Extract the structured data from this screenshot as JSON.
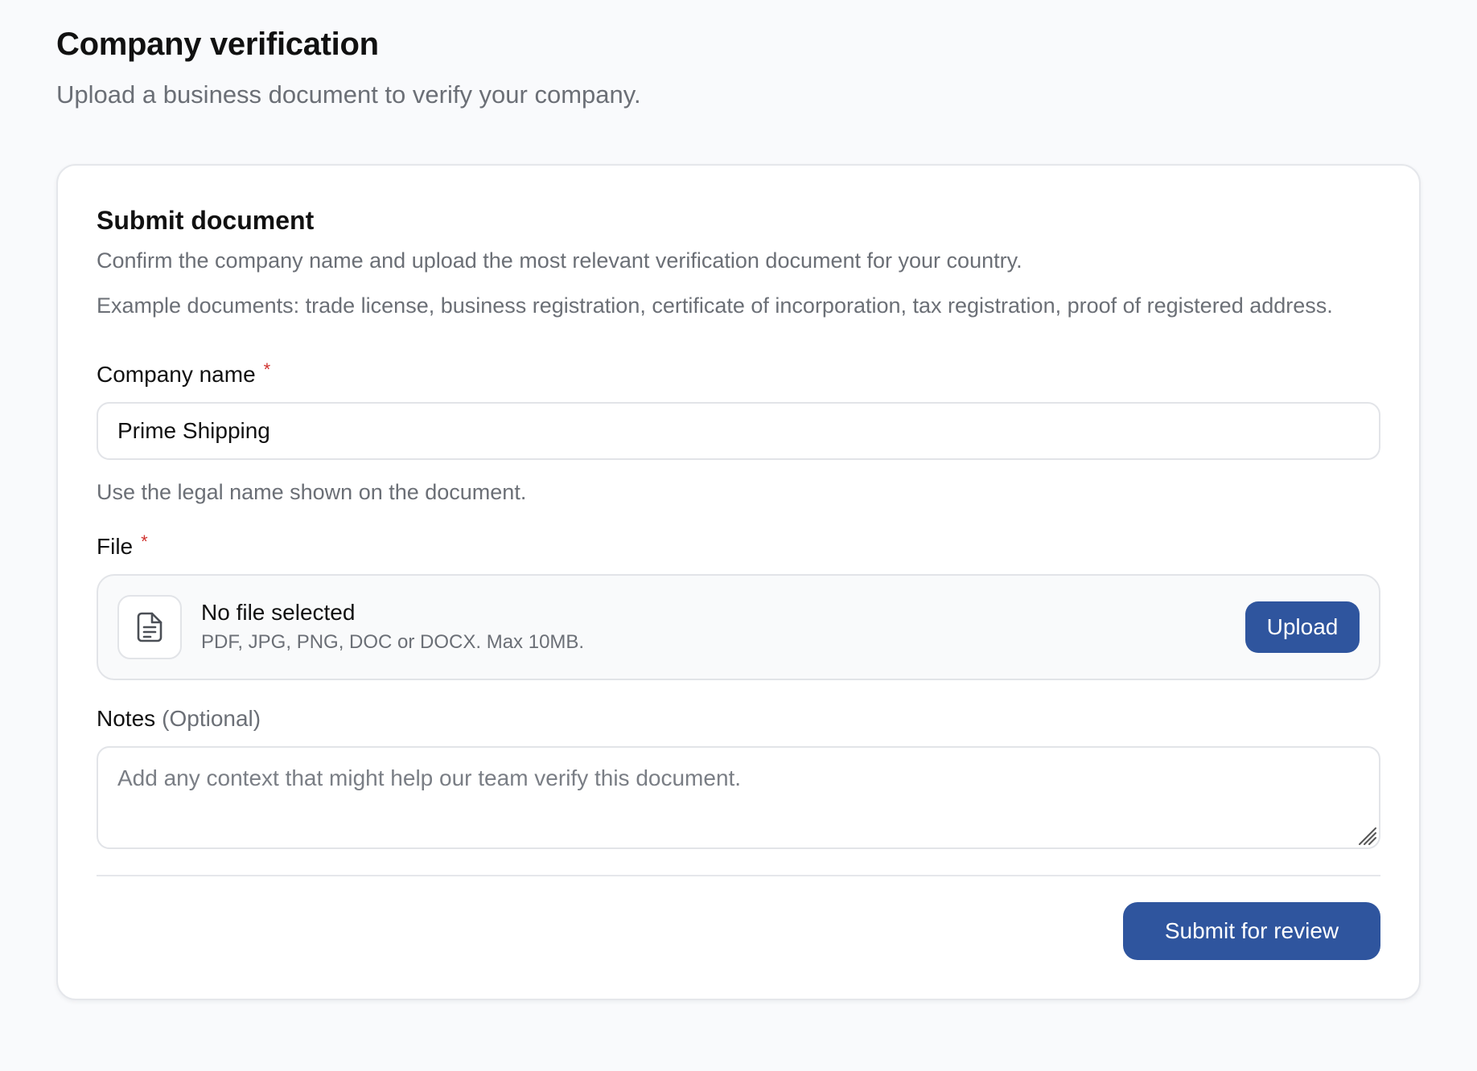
{
  "header": {
    "title": "Company verification",
    "subtitle": "Upload a business document to verify your company."
  },
  "card": {
    "title": "Submit document",
    "description": "Confirm the company name and upload the most relevant verification document for your country.",
    "examples": "Example documents: trade license, business registration, certificate of incorporation, tax registration, proof of registered address."
  },
  "company_name": {
    "label": "Company name",
    "required_mark": "*",
    "value": "Prime Shipping",
    "helper": "Use the legal name shown on the document."
  },
  "file": {
    "label": "File",
    "required_mark": "*",
    "status": "No file selected",
    "hint": "PDF, JPG, PNG, DOC or DOCX. Max 10MB.",
    "upload_label": "Upload",
    "icon": "document-icon"
  },
  "notes": {
    "label": "Notes",
    "optional": "(Optional)",
    "placeholder": "Add any context that might help our team verify this document.",
    "value": ""
  },
  "actions": {
    "submit_label": "Submit for review"
  },
  "colors": {
    "primary": "#2f559e",
    "required": "#d0312d",
    "muted_text": "#6b6f76",
    "border": "#e2e4e8",
    "page_background": "#f9fafc"
  }
}
